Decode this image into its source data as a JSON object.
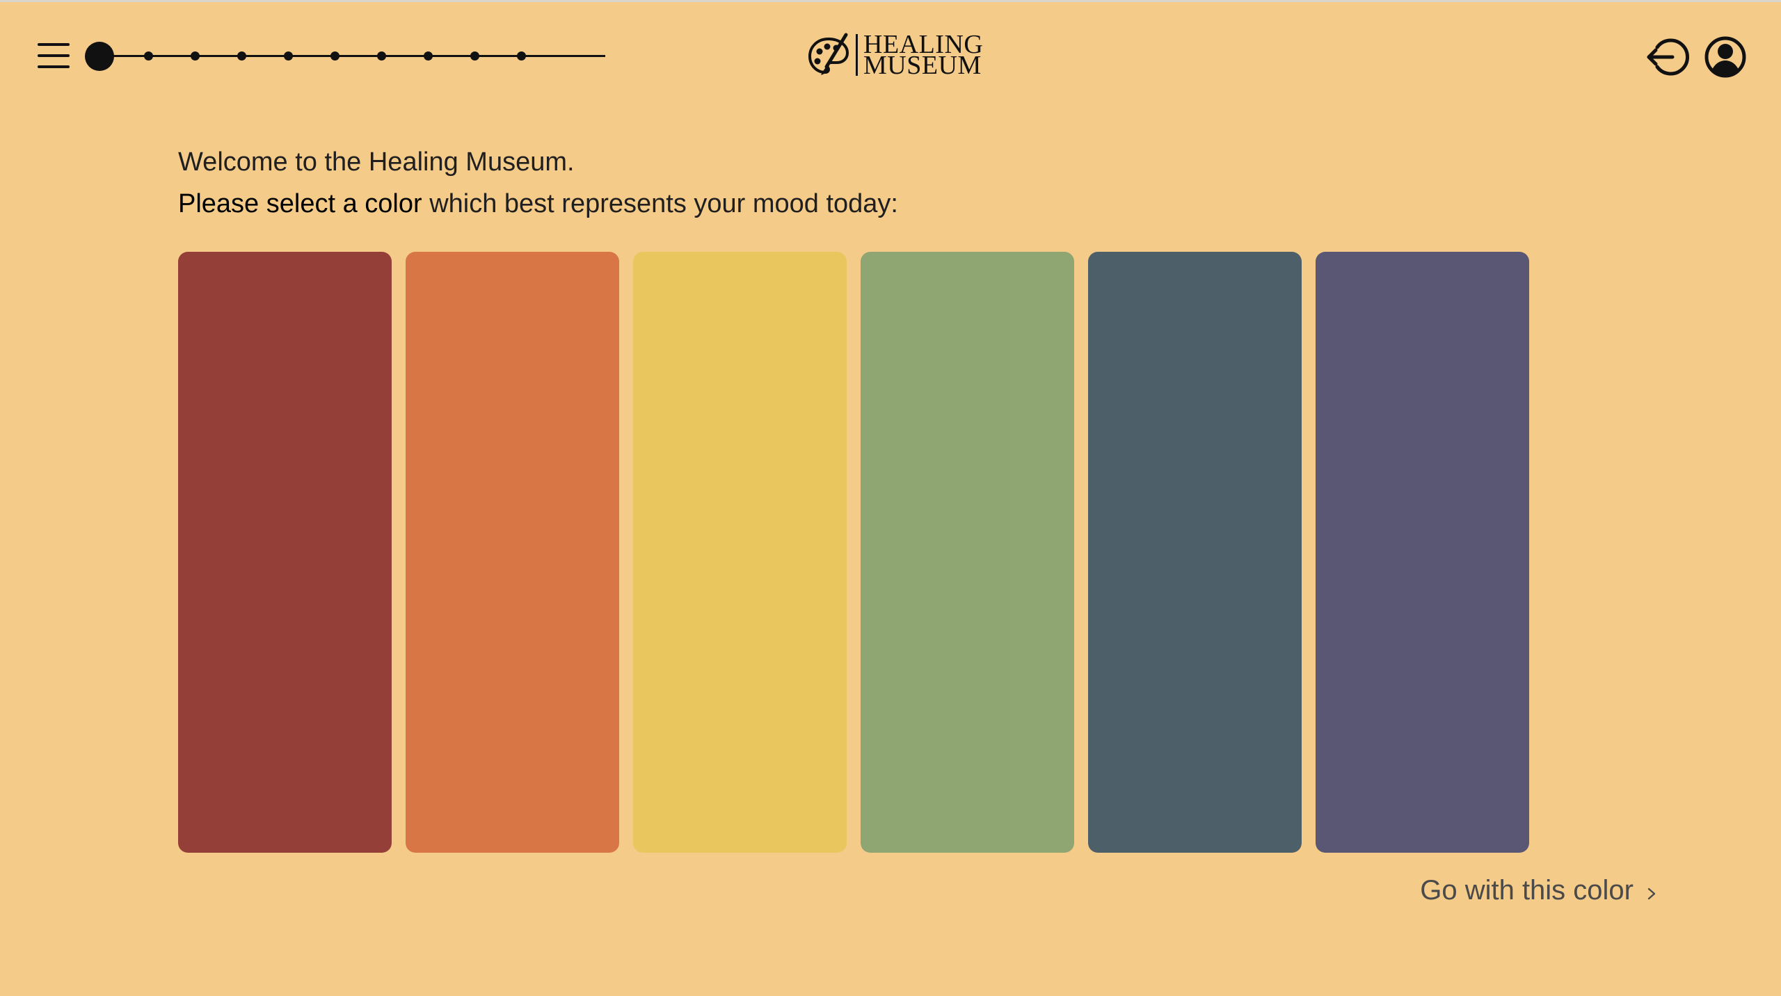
{
  "app": {
    "logo_line1": "HEALING",
    "logo_line2": "MUSEUM"
  },
  "header": {
    "menu_icon": "hamburger-menu-icon",
    "progress": {
      "current_step": 1,
      "total_steps": 10
    },
    "logout_icon": "logout-arrow-icon",
    "profile_icon": "user-profile-icon"
  },
  "main": {
    "welcome_text": "Welcome to the Healing Museum.",
    "prompt_bold": "Please select a color",
    "prompt_rest": " which best represents your mood today:",
    "colors": [
      "#943f37",
      "#d97645",
      "#eac75e",
      "#8fa672",
      "#4d606a",
      "#5a5774"
    ],
    "go_label": "Go with this color",
    "go_icon": "chevron-right-icon"
  }
}
